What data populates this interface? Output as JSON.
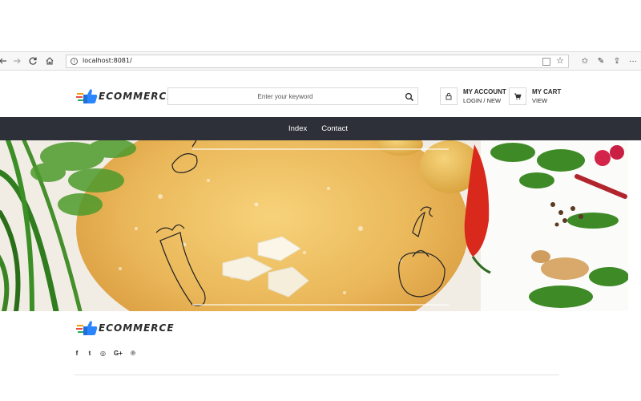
{
  "browser": {
    "url": "localhost:8081/",
    "back_icon": "back-arrow-icon",
    "forward_icon": "forward-arrow-icon",
    "refresh_icon": "refresh-icon",
    "home_icon": "home-icon"
  },
  "header": {
    "logo_text": "ECOMMERCE",
    "search_placeholder": "Enter your keyword",
    "account": {
      "title": "MY ACCOUNT",
      "subtitle": "LOGIN / NEW"
    },
    "cart": {
      "title": "MY CART",
      "subtitle": "VIEW"
    }
  },
  "nav": {
    "items": [
      {
        "label": "Index"
      },
      {
        "label": "Contact"
      }
    ]
  },
  "hero": {
    "image": "food-banner-pie-vegetables"
  },
  "footer": {
    "logo_text": "ECOMMERCE",
    "social": [
      {
        "label": "f",
        "icon": "facebook-icon"
      },
      {
        "label": "t",
        "icon": "twitter-icon"
      },
      {
        "label": "◎",
        "icon": "instagram-icon"
      },
      {
        "label": "G+",
        "icon": "google-plus-icon"
      },
      {
        "label": "℗",
        "icon": "pinterest-icon"
      }
    ]
  },
  "colors": {
    "navbar_bg": "#2d3038",
    "nav_text": "#ffffff",
    "logo_blue": "#1e6fd9",
    "logo_orange": "#f39c12"
  }
}
